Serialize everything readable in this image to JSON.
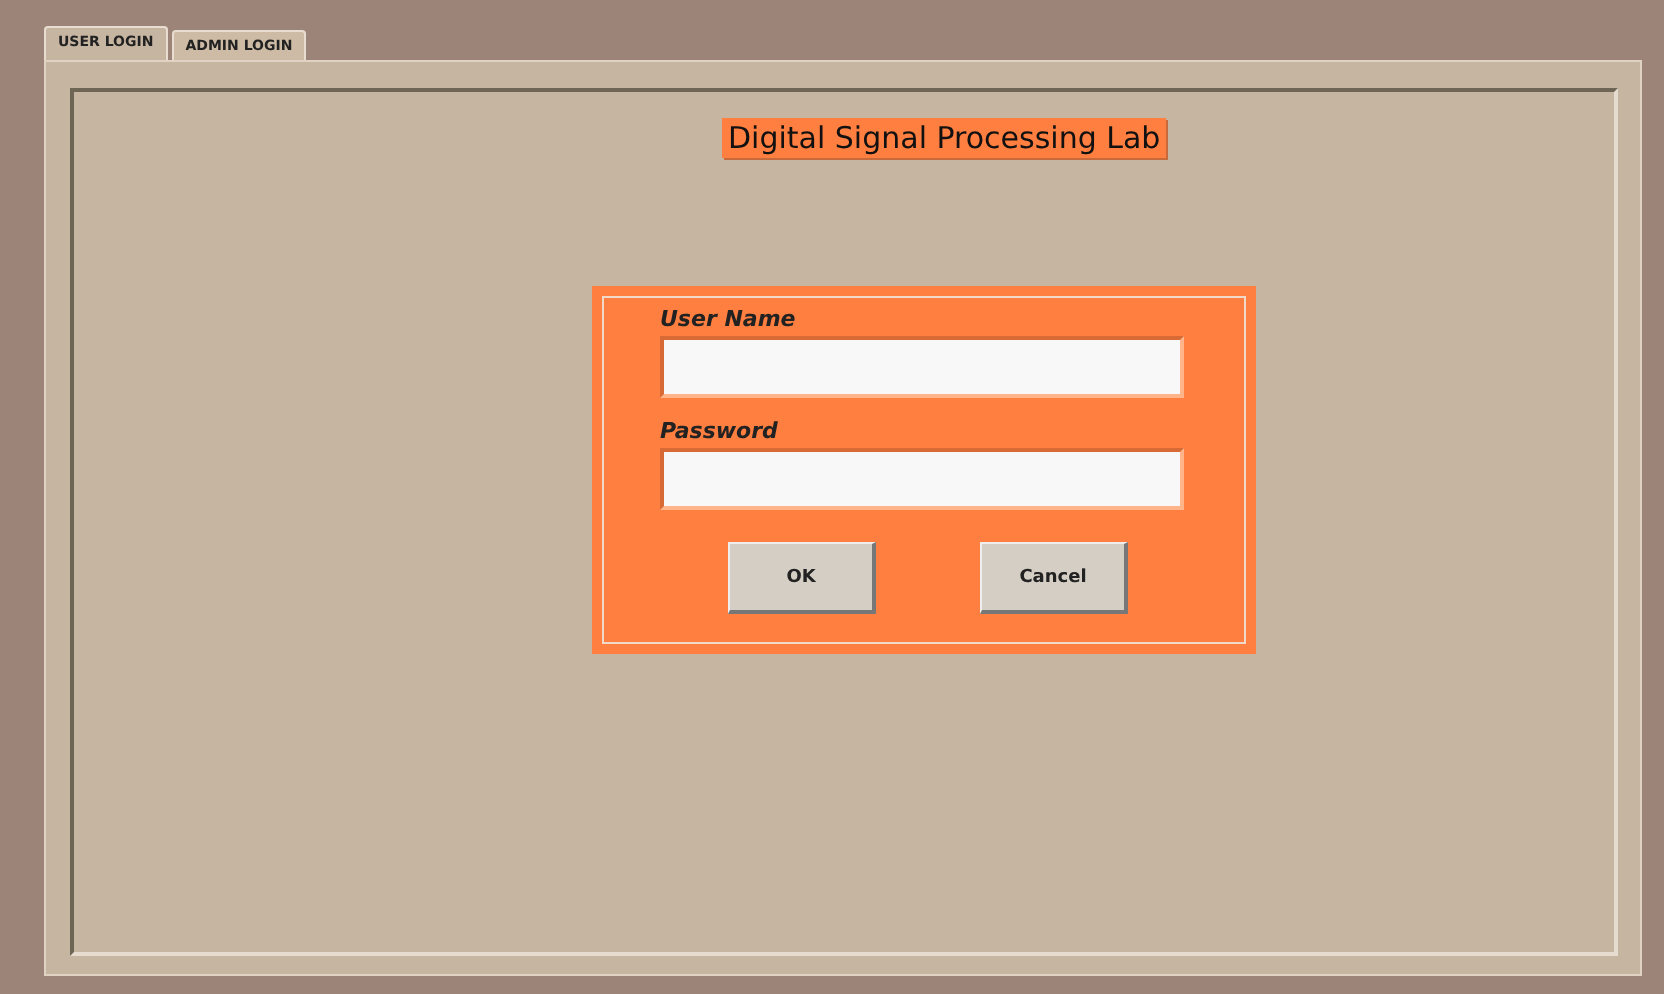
{
  "tabs": [
    {
      "label": "USER LOGIN",
      "selected": true
    },
    {
      "label": "ADMIN LOGIN",
      "selected": false
    }
  ],
  "title": "Digital Signal Processing Lab",
  "login": {
    "fields": [
      {
        "label": "User Name"
      },
      {
        "label": "Password"
      }
    ],
    "buttons": [
      "OK",
      "Cancel"
    ]
  }
}
